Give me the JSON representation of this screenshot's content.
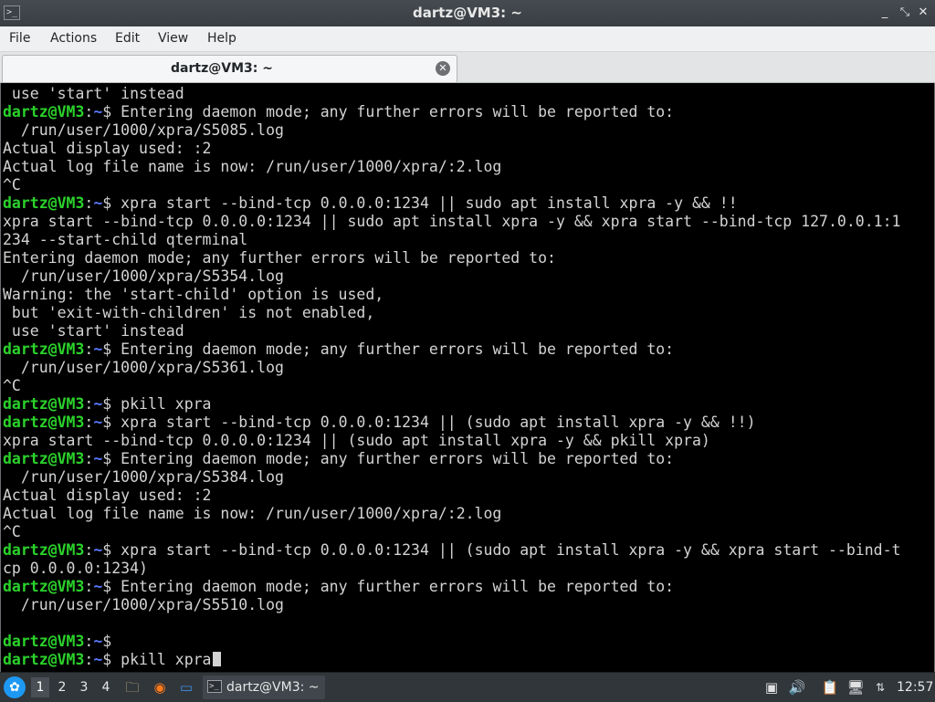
{
  "window": {
    "title": "dartz@VM3: ~",
    "app_icon_glyph": ">_",
    "controls": {
      "minimize": "_",
      "maximize": "⤡",
      "close": "✕"
    }
  },
  "menubar": {
    "items": [
      "File",
      "Actions",
      "Edit",
      "View",
      "Help"
    ]
  },
  "tabs": [
    {
      "label": "dartz@VM3: ~",
      "close_icon": "✕"
    }
  ],
  "terminal": {
    "colors": {
      "background": "#000000",
      "text": "#d3d3d3",
      "user": "#2bd22b",
      "path": "#5a78ff"
    },
    "lines": [
      {
        "text": " use 'start' instead"
      },
      {
        "prompt": true,
        "user": "dartz@VM3",
        "path": "~",
        "text": " Entering daemon mode; any further errors will be reported to:"
      },
      {
        "text": "  /run/user/1000/xpra/S5085.log"
      },
      {
        "text": "Actual display used: :2"
      },
      {
        "text": "Actual log file name is now: /run/user/1000/xpra/:2.log"
      },
      {
        "text": "^C"
      },
      {
        "prompt": true,
        "user": "dartz@VM3",
        "path": "~",
        "text": " xpra start --bind-tcp 0.0.0.0:1234 || sudo apt install xpra -y && !!"
      },
      {
        "text": "xpra start --bind-tcp 0.0.0.0:1234 || sudo apt install xpra -y && xpra start --bind-tcp 127.0.0.1:1"
      },
      {
        "text": "234 --start-child qterminal"
      },
      {
        "text": "Entering daemon mode; any further errors will be reported to:"
      },
      {
        "text": "  /run/user/1000/xpra/S5354.log"
      },
      {
        "text": "Warning: the 'start-child' option is used,"
      },
      {
        "text": " but 'exit-with-children' is not enabled,"
      },
      {
        "text": " use 'start' instead"
      },
      {
        "prompt": true,
        "user": "dartz@VM3",
        "path": "~",
        "text": " Entering daemon mode; any further errors will be reported to:"
      },
      {
        "text": "  /run/user/1000/xpra/S5361.log"
      },
      {
        "text": "^C"
      },
      {
        "prompt": true,
        "user": "dartz@VM3",
        "path": "~",
        "text": " pkill xpra"
      },
      {
        "prompt": true,
        "user": "dartz@VM3",
        "path": "~",
        "text": " xpra start --bind-tcp 0.0.0.0:1234 || (sudo apt install xpra -y && !!)"
      },
      {
        "text": "xpra start --bind-tcp 0.0.0.0:1234 || (sudo apt install xpra -y && pkill xpra)"
      },
      {
        "prompt": true,
        "user": "dartz@VM3",
        "path": "~",
        "text": " Entering daemon mode; any further errors will be reported to:"
      },
      {
        "text": "  /run/user/1000/xpra/S5384.log"
      },
      {
        "text": "Actual display used: :2"
      },
      {
        "text": "Actual log file name is now: /run/user/1000/xpra/:2.log"
      },
      {
        "text": "^C"
      },
      {
        "prompt": true,
        "user": "dartz@VM3",
        "path": "~",
        "text": " xpra start --bind-tcp 0.0.0.0:1234 || (sudo apt install xpra -y && xpra start --bind-t"
      },
      {
        "text": "cp 0.0.0.0:1234)"
      },
      {
        "prompt": true,
        "user": "dartz@VM3",
        "path": "~",
        "text": " Entering daemon mode; any further errors will be reported to:"
      },
      {
        "text": "  /run/user/1000/xpra/S5510.log"
      },
      {
        "text": ""
      },
      {
        "prompt": true,
        "user": "dartz@VM3",
        "path": "~",
        "text": ""
      },
      {
        "prompt": true,
        "user": "dartz@VM3",
        "path": "~",
        "text": " pkill xpra",
        "cursor": true
      }
    ]
  },
  "taskbar": {
    "start_icon": "start-menu-icon",
    "workspaces": [
      {
        "label": "1",
        "active": true
      },
      {
        "label": "2",
        "active": false
      },
      {
        "label": "3",
        "active": false
      },
      {
        "label": "4",
        "active": false
      }
    ],
    "launchers": [
      {
        "name": "file-manager-icon",
        "glyph": "🗀"
      },
      {
        "name": "firefox-icon",
        "glyph": "◉"
      },
      {
        "name": "desktop-icon",
        "glyph": "▭"
      }
    ],
    "task": {
      "label": "dartz@VM3: ~",
      "icon_glyph": ">_"
    },
    "tray": [
      {
        "name": "tray-app-icon",
        "glyph": "▣"
      },
      {
        "name": "volume-icon",
        "glyph": "🔊"
      },
      {
        "name": "clipboard-icon",
        "glyph": "📋"
      },
      {
        "name": "network-icon",
        "glyph": "🖥"
      },
      {
        "name": "update-notifier-icon",
        "glyph": "⇅"
      }
    ],
    "clock": "12:57"
  }
}
